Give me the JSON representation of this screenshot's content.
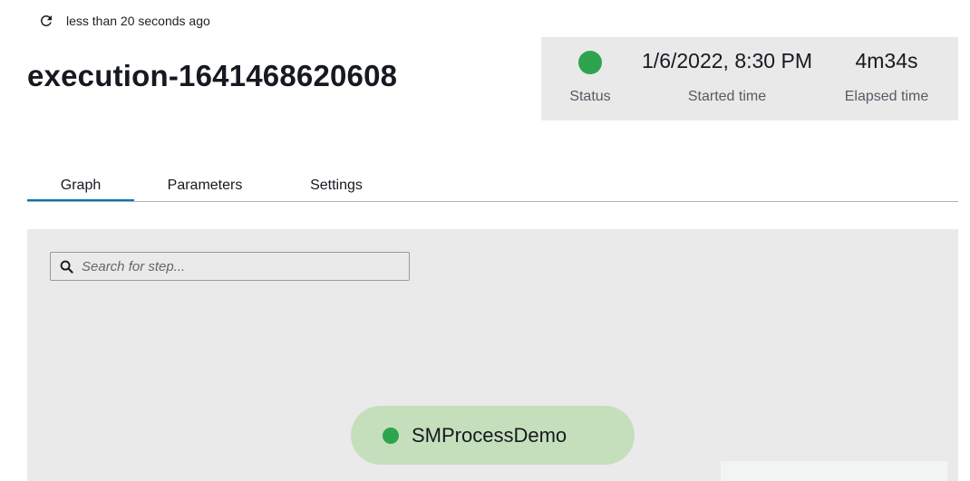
{
  "refresh": {
    "icon": "refresh-icon",
    "text": "less than 20 seconds ago"
  },
  "title": "execution-1641468620608",
  "summary": {
    "status_color": "#2ea44f",
    "status_label": "Status",
    "started_value": "1/6/2022, 8:30 PM",
    "started_label": "Started time",
    "elapsed_value": "4m34s",
    "elapsed_label": "Elapsed time"
  },
  "tabs": [
    {
      "label": "Graph",
      "active": true
    },
    {
      "label": "Parameters",
      "active": false
    },
    {
      "label": "Settings",
      "active": false
    }
  ],
  "graph": {
    "search_placeholder": "Search for step...",
    "nodes": [
      {
        "label": "SMProcessDemo",
        "status_color": "#2ea44f"
      }
    ]
  },
  "colors": {
    "accent": "#0073bb",
    "success": "#2ea44f",
    "node_fill": "#c5dfbc"
  }
}
